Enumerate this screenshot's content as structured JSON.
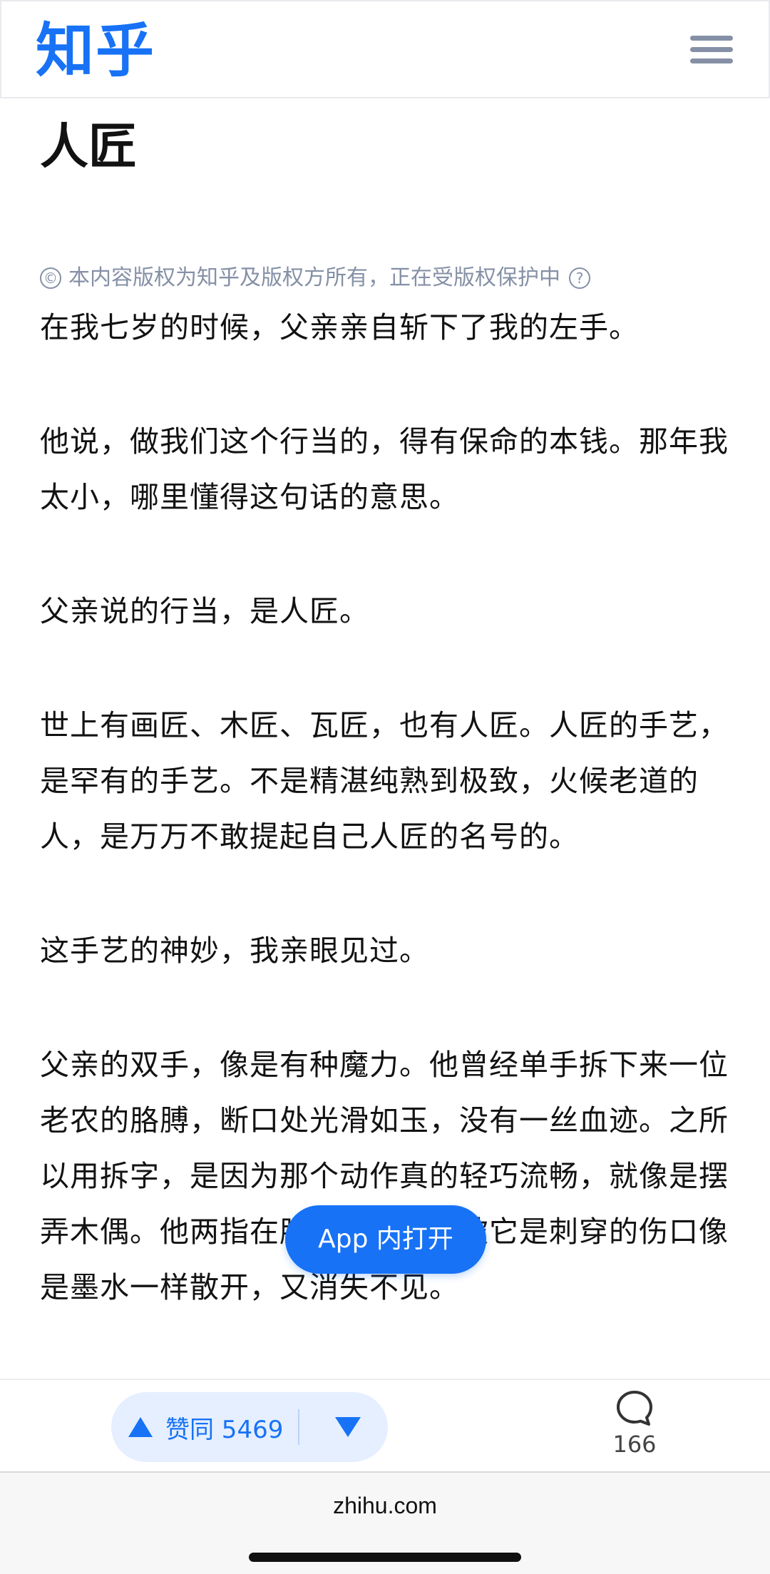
{
  "header": {
    "logo": "知乎",
    "menu_icon": "hamburger-menu-icon"
  },
  "article": {
    "title": "人匠",
    "copyright_notice": "本内容版权为知乎及版权方所有，正在受版权保护中",
    "copyright_symbol": "©",
    "help_symbol": "?",
    "paragraphs": [
      "在我七岁的时候，父亲亲自斩下了我的左手。",
      "他说，做我们这个行当的，得有保命的本钱。那年我太小，哪里懂得这句话的意思。",
      "父亲说的行当，是人匠。",
      "世上有画匠、木匠、瓦匠，也有人匠。人匠的手艺，是罕有的手艺。不是精湛纯熟到极致，火候老道的人，是万万不敢提起自己人匠的名号的。",
      "这手艺的神妙，我亲眼见过。",
      "父亲的双手，像是有种魔力。他曾经单手拆下来一位老农的胳膊，断口处光滑如玉，没有一丝血迹。之所以用拆字，是因为那个动作真的轻巧流畅，就像是摆弄木偶。他两指在胳膊上划过，被它是刺穿的伤口像是墨水一样散开，又消失不见。"
    ]
  },
  "floating": {
    "open_app_label": "App 内打开"
  },
  "action_bar": {
    "upvote_label": "赞同 5469",
    "upvote_icon": "triangle-up-icon",
    "downvote_icon": "triangle-down-icon",
    "comment_icon": "comment-bubble-icon",
    "comment_count": "166"
  },
  "browser": {
    "url": "zhihu.com"
  },
  "colors": {
    "brand": "#1772f6",
    "muted": "#8590a6",
    "vote_bg": "#e5efff"
  }
}
